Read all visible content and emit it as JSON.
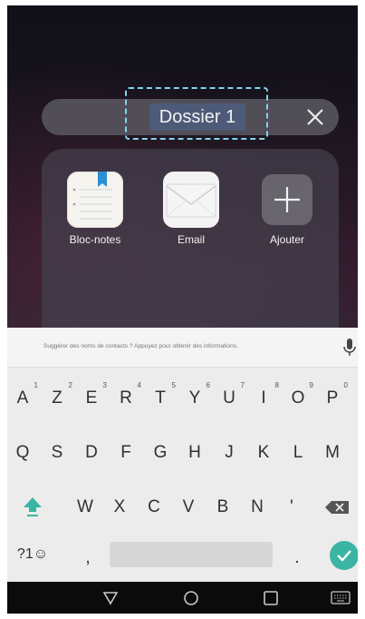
{
  "folder": {
    "name_value": "Dossier 1",
    "apps": [
      {
        "label": "Bloc-notes",
        "icon": "notepad-icon"
      },
      {
        "label": "Email",
        "icon": "envelope-icon"
      },
      {
        "label": "Ajouter",
        "icon": "plus-icon"
      }
    ]
  },
  "keyboard": {
    "suggestion_hint": "Suggérer des noms de contacts ? Appuyez pour obtenir des informations.",
    "row1": [
      {
        "key": "A",
        "num": "1"
      },
      {
        "key": "Z",
        "num": "2"
      },
      {
        "key": "E",
        "num": "3"
      },
      {
        "key": "R",
        "num": "4"
      },
      {
        "key": "T",
        "num": "5"
      },
      {
        "key": "Y",
        "num": "6"
      },
      {
        "key": "U",
        "num": "7"
      },
      {
        "key": "I",
        "num": "8"
      },
      {
        "key": "O",
        "num": "9"
      },
      {
        "key": "P",
        "num": "0"
      }
    ],
    "row2": [
      "Q",
      "S",
      "D",
      "F",
      "G",
      "H",
      "J",
      "K",
      "L",
      "M"
    ],
    "row3": [
      "W",
      "X",
      "C",
      "V",
      "B",
      "N",
      "'"
    ],
    "symbols_key": "?1☺",
    "comma_key": ",",
    "period_key": ".",
    "accent_color": "#3bb5a3"
  },
  "colors": {
    "selection": "#4d5a78",
    "dash_outline": "#7fd7e8"
  }
}
